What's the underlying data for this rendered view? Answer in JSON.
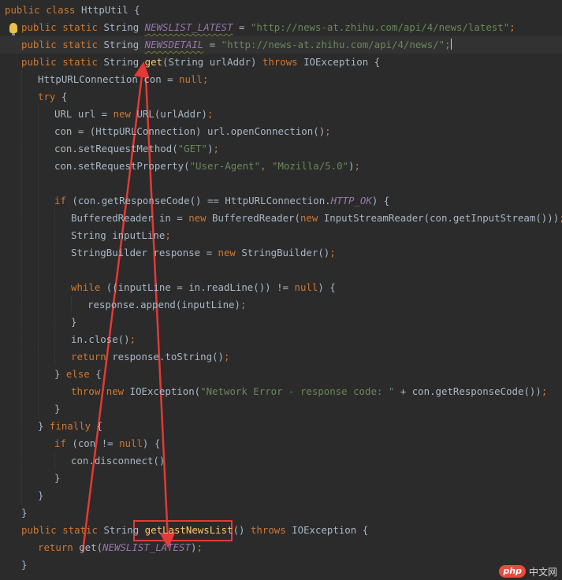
{
  "editor": {
    "lines": [
      [
        {
          "t": "public class ",
          "c": "kw"
        },
        {
          "t": "HttpUtil {",
          "c": "plain"
        }
      ],
      [
        {
          "t": "public static ",
          "c": "kw"
        },
        {
          "t": "String ",
          "c": "plain"
        },
        {
          "t": "NEWSLIST_LATEST",
          "c": "const"
        },
        {
          "t": " = ",
          "c": "plain"
        },
        {
          "t": "\"http://news-at.zhihu.com/api/4/news/latest\"",
          "c": "str"
        },
        {
          "t": ";",
          "c": "kw"
        }
      ],
      [
        {
          "t": "public static ",
          "c": "kw"
        },
        {
          "t": "String ",
          "c": "plain"
        },
        {
          "t": "NEWSDETAIL",
          "c": "const"
        },
        {
          "t": " = ",
          "c": "plain"
        },
        {
          "t": "\"http://news-at.zhihu.com/api/4/news/\"",
          "c": "str"
        },
        {
          "t": ";",
          "c": "kw"
        }
      ],
      [
        {
          "t": "public static ",
          "c": "kw"
        },
        {
          "t": "String ",
          "c": "plain"
        },
        {
          "t": "get",
          "c": "fn"
        },
        {
          "t": "(String urlAddr) ",
          "c": "plain"
        },
        {
          "t": "throws ",
          "c": "kw"
        },
        {
          "t": "IOException {",
          "c": "plain"
        }
      ],
      [
        {
          "t": "HttpURLConnection con = ",
          "c": "plain"
        },
        {
          "t": "null;",
          "c": "kw"
        }
      ],
      [
        {
          "t": "try ",
          "c": "kw"
        },
        {
          "t": "{",
          "c": "plain"
        }
      ],
      [
        {
          "t": "URL url = ",
          "c": "plain"
        },
        {
          "t": "new ",
          "c": "kw"
        },
        {
          "t": "URL(urlAddr)",
          "c": "plain"
        },
        {
          "t": ";",
          "c": "kw"
        }
      ],
      [
        {
          "t": "con = (HttpURLConnection) url.openConnection()",
          "c": "plain"
        },
        {
          "t": ";",
          "c": "kw"
        }
      ],
      [
        {
          "t": "con.setRequestMethod(",
          "c": "plain"
        },
        {
          "t": "\"GET\"",
          "c": "str"
        },
        {
          "t": ")",
          "c": "plain"
        },
        {
          "t": ";",
          "c": "kw"
        }
      ],
      [
        {
          "t": "con.setRequestProperty(",
          "c": "plain"
        },
        {
          "t": "\"User-Agent\"",
          "c": "str"
        },
        {
          "t": ", ",
          "c": "kw"
        },
        {
          "t": "\"Mozilla/5.0\"",
          "c": "str"
        },
        {
          "t": ")",
          "c": "plain"
        },
        {
          "t": ";",
          "c": "kw"
        }
      ],
      [],
      [
        {
          "t": "if ",
          "c": "kw"
        },
        {
          "t": "(con.getResponseCode() == HttpURLConnection.",
          "c": "plain"
        },
        {
          "t": "HTTP_OK",
          "c": "const"
        },
        {
          "t": ") {",
          "c": "plain"
        }
      ],
      [
        {
          "t": "BufferedReader in = ",
          "c": "plain"
        },
        {
          "t": "new ",
          "c": "kw"
        },
        {
          "t": "BufferedReader(",
          "c": "plain"
        },
        {
          "t": "new ",
          "c": "kw"
        },
        {
          "t": "InputStreamReader(con.getInputStream()))",
          "c": "plain"
        },
        {
          "t": ";",
          "c": "kw"
        }
      ],
      [
        {
          "t": "String inputLine",
          "c": "plain"
        },
        {
          "t": ";",
          "c": "kw"
        }
      ],
      [
        {
          "t": "StringBuilder response = ",
          "c": "plain"
        },
        {
          "t": "new ",
          "c": "kw"
        },
        {
          "t": "StringBuilder()",
          "c": "plain"
        },
        {
          "t": ";",
          "c": "kw"
        }
      ],
      [],
      [
        {
          "t": "while ",
          "c": "kw"
        },
        {
          "t": "((inputLine = in.readLine()) != ",
          "c": "plain"
        },
        {
          "t": "null",
          "c": "kw"
        },
        {
          "t": ") {",
          "c": "plain"
        }
      ],
      [
        {
          "t": "response.append(inputLine)",
          "c": "plain"
        },
        {
          "t": ";",
          "c": "kw"
        }
      ],
      [
        {
          "t": "}",
          "c": "plain"
        }
      ],
      [
        {
          "t": "in.close()",
          "c": "plain"
        },
        {
          "t": ";",
          "c": "kw"
        }
      ],
      [
        {
          "t": "return ",
          "c": "kw"
        },
        {
          "t": "response.toString()",
          "c": "plain"
        },
        {
          "t": ";",
          "c": "kw"
        }
      ],
      [
        {
          "t": "} ",
          "c": "plain"
        },
        {
          "t": "else ",
          "c": "kw"
        },
        {
          "t": "{",
          "c": "plain"
        }
      ],
      [
        {
          "t": "throw new ",
          "c": "kw"
        },
        {
          "t": "IOException(",
          "c": "plain"
        },
        {
          "t": "\"Network Error - response code: \"",
          "c": "str"
        },
        {
          "t": " + con.getResponseCode())",
          "c": "plain"
        },
        {
          "t": ";",
          "c": "kw"
        }
      ],
      [
        {
          "t": "}",
          "c": "plain"
        }
      ],
      [
        {
          "t": "} ",
          "c": "plain"
        },
        {
          "t": "finally ",
          "c": "kw"
        },
        {
          "t": "{",
          "c": "plain"
        }
      ],
      [
        {
          "t": "if ",
          "c": "kw"
        },
        {
          "t": "(con != ",
          "c": "plain"
        },
        {
          "t": "null",
          "c": "kw"
        },
        {
          "t": ") {",
          "c": "plain"
        }
      ],
      [
        {
          "t": "con.disconnect()",
          "c": "plain"
        }
      ],
      [
        {
          "t": "}",
          "c": "plain"
        }
      ],
      [
        {
          "t": "}",
          "c": "plain"
        }
      ],
      [
        {
          "t": "}",
          "c": "plain"
        }
      ],
      [
        {
          "t": "public static ",
          "c": "kw"
        },
        {
          "t": "String ",
          "c": "plain"
        },
        {
          "t": "getLastNewsList",
          "c": "fn"
        },
        {
          "t": "() ",
          "c": "plain"
        },
        {
          "t": "throws ",
          "c": "kw"
        },
        {
          "t": "IOException {",
          "c": "plain"
        }
      ],
      [
        {
          "t": "return ",
          "c": "kw"
        },
        {
          "t": "get(",
          "c": "plain"
        },
        {
          "t": "NEWSLIST_LATEST",
          "c": "const"
        },
        {
          "t": ")",
          "c": "plain"
        },
        {
          "t": ";",
          "c": "kw"
        }
      ],
      [
        {
          "t": "}",
          "c": "plain"
        }
      ]
    ]
  },
  "colors": {
    "keyword": "#cc7832",
    "string": "#6a8759",
    "constant": "#9876aa",
    "method": "#ffc66d",
    "text": "#a9b7c6",
    "background": "#2b2b2b",
    "annotation": "#e53935"
  },
  "watermark": {
    "logo": "php",
    "text": "中文网"
  }
}
